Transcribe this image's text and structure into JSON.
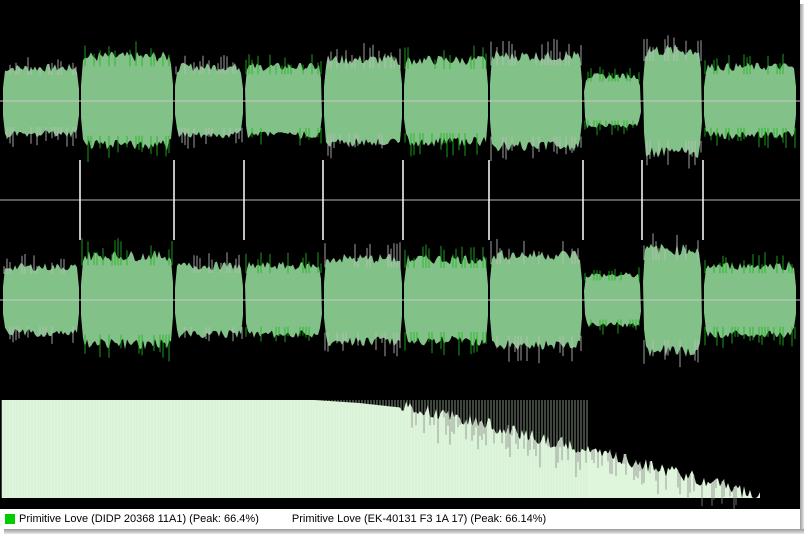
{
  "colors": {
    "background": "#000000",
    "waveform_fill": "#82c187",
    "waveform_peak_a": "#1fb51f",
    "waveform_peak_b": "#bdbdbd",
    "center_line": "#c9c9c9",
    "track_marker": "#ffffff",
    "spectrum_fill": "#dff5dc",
    "spectrum_grey": "#8a8a8a",
    "legend_a": "#00cc00",
    "legend_b": "#ffffff"
  },
  "legend": {
    "items": [
      {
        "label": "Primitive Love (DIDP 20368 11A1) (Peak: 66.4%)",
        "color": "#00cc00"
      },
      {
        "label": "Primitive Love (EK-40131 F3 1A 17) (Peak: 66.14%)",
        "color": "#ffffff"
      }
    ]
  },
  "tracks": [
    {
      "amplitude": 0.6
    },
    {
      "amplitude": 0.8
    },
    {
      "amplitude": 0.62
    },
    {
      "amplitude": 0.62
    },
    {
      "amplitude": 0.75
    },
    {
      "amplitude": 0.74
    },
    {
      "amplitude": 0.82
    },
    {
      "amplitude": 0.45
    },
    {
      "amplitude": 0.92
    },
    {
      "amplitude": 0.62
    }
  ],
  "spectrum": {
    "description_levels": [
      1.0,
      1.0,
      1.0,
      1.0,
      1.0,
      1.0,
      1.0,
      1.0,
      0.97,
      0.92,
      0.85,
      0.74,
      0.62,
      0.5,
      0.38,
      0.27,
      0.15,
      0.0
    ]
  }
}
